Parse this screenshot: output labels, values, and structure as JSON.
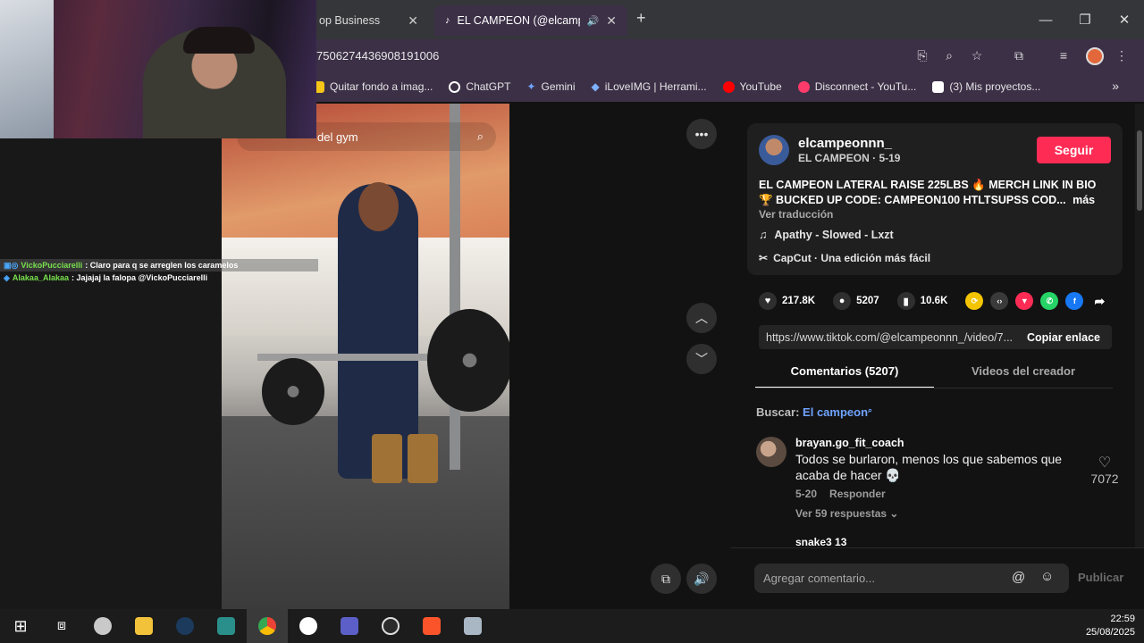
{
  "browser": {
    "tabs": [
      {
        "label": "op Business",
        "active": false
      },
      {
        "label": "EL CAMPEON (@elcampeo",
        "active": true
      }
    ],
    "url": "7506274436908191006",
    "bookmarks": [
      {
        "label": "Quitar fondo a imag...",
        "icon": "image-icon",
        "color": "#f5c518"
      },
      {
        "label": "ChatGPT",
        "icon": "chatgpt-icon",
        "color": "#ffffff"
      },
      {
        "label": "Gemini",
        "icon": "gemini-icon",
        "color": "#6fa3ff"
      },
      {
        "label": "iLoveIMG | Herrami...",
        "icon": "heart-icon",
        "color": "#7fb0ff"
      },
      {
        "label": "YouTube",
        "icon": "youtube-icon",
        "color": "#ff0000"
      },
      {
        "label": "Disconnect - YouTu...",
        "icon": "disconnect-icon",
        "color": "#ff3b6b"
      },
      {
        "label": "(3)  Mis proyectos...",
        "icon": "capcut-icon",
        "color": "#ffffff"
      }
    ]
  },
  "chat": {
    "lines": [
      {
        "user": "VickoPucciarelli",
        "message": ": Claro para q se arreglen los caramelos"
      },
      {
        "user": "Alakaa_Alakaa",
        "message": ": Jajajaj la falopa @VickoPucciarelli"
      }
    ]
  },
  "video": {
    "search_text": "del gym"
  },
  "post": {
    "username": "elcampeonnn_",
    "subline": "EL CAMPEON · 5-19",
    "follow_label": "Seguir",
    "description": "EL CAMPEON LATERAL RAISE 225LBS 🔥 MERCH LINK IN BIO 🏆 BUCKED UP CODE: CAMPEON100 HTLTSUPSS COD...",
    "more_label": "más",
    "translate_label": "Ver traducción",
    "music": "Apathy - Slowed - Lxzt",
    "capcut": "CapCut · Una edición más fácil",
    "likes": "217.8K",
    "comments": "5207",
    "saves": "10.6K",
    "share_link": "https://www.tiktok.com/@elcampeonnn_/video/7...",
    "copy_label": "Copiar enlace"
  },
  "tabs": {
    "comments": "Comentarios (5207)",
    "creator": "Videos del creador"
  },
  "search": {
    "prefix": "Buscar:",
    "keyword": "El campeon"
  },
  "comments": [
    {
      "user": "brayan.go_fit_coach",
      "text": "Todos se burlaron, menos los que sabemos que acaba de hacer 💀",
      "date": "5-20",
      "reply": "Responder",
      "replies": "Ver 59 respuestas",
      "likes": "7072"
    },
    {
      "user": "snake3 13"
    }
  ],
  "comment_input": {
    "placeholder": "Agregar comentario...",
    "publish": "Publicar"
  },
  "taskbar": {
    "time": "22:59",
    "date": "25/08/2025"
  }
}
